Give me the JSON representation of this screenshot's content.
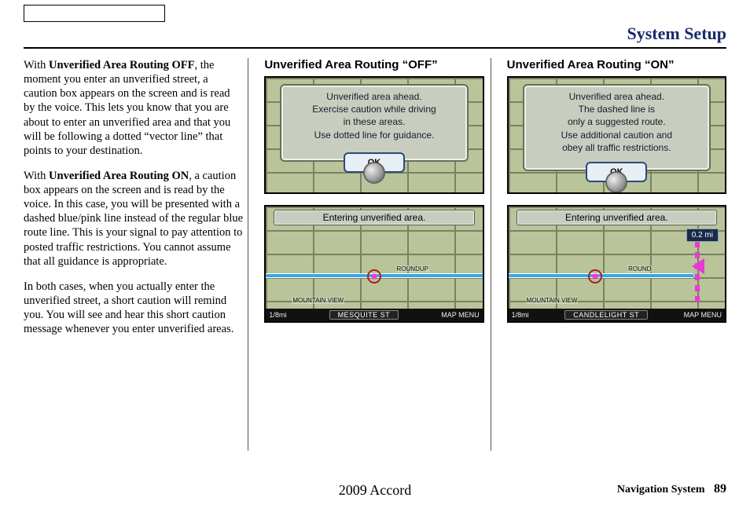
{
  "header": {
    "title": "System Setup"
  },
  "col1": {
    "p1_prefix": "With ",
    "p1_bold": "Unverified Area Routing OFF",
    "p1_rest": ", the moment you enter an unverified street, a caution box appears on the screen and is read by the voice. This lets you know that you are about to enter an unverified area and that you will be following a dotted “vector line” that points to your destination.",
    "p2_prefix": "With ",
    "p2_bold": "Unverified Area Routing ON",
    "p2_rest": ", a caution box appears on the screen and is read by the voice. In this case, you will be presented with a dashed blue/pink line instead of the regular blue route line. This is your signal to pay attention to posted traffic restrictions. You cannot assume that all guidance is appropriate.",
    "p3": "In both cases, when you actually enter the unverified street, a short caution will remind you. You will see and hear this short caution message whenever you enter unverified areas."
  },
  "col2": {
    "heading": "Unverified Area Routing “OFF”",
    "dialog": {
      "line1": "Unverified area ahead.",
      "line2": "Exercise caution while driving",
      "line3": "in these areas.",
      "line4": "Use dotted line for guidance.",
      "ok": "OK"
    },
    "shot2": {
      "status": "Entering unverified area.",
      "scale": "1/8mi",
      "street": "MESQUITE ST",
      "menu": "MAP MENU",
      "label_roundup": "ROUNDUP",
      "label_mtnview": "MOUNTAIN VIEW"
    }
  },
  "col3": {
    "heading": "Unverified Area Routing “ON”",
    "dialog": {
      "line1": "Unverified area ahead.",
      "line2": "The dashed line is",
      "line3": "only a suggested route.",
      "line4": "Use additional caution and",
      "line5": "obey all traffic restrictions.",
      "ok": "OK"
    },
    "shot2": {
      "status": "Entering unverified area.",
      "dist": "0.2 mi",
      "scale": "1/8mi",
      "street": "CANDLELIGHT ST",
      "menu": "MAP MENU",
      "label_roundup": "ROUND",
      "label_mtnview": "MOUNTAIN VIEW"
    }
  },
  "footer": {
    "model": "2009  Accord",
    "section": "Navigation System",
    "page": "89"
  }
}
